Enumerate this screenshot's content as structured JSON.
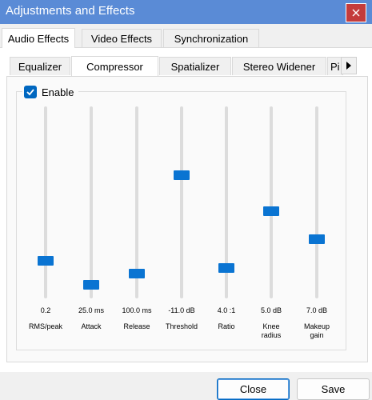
{
  "window": {
    "title": "Adjustments and Effects"
  },
  "outer_tabs": [
    "Audio Effects",
    "Video Effects",
    "Synchronization"
  ],
  "inner_tabs": [
    "Equalizer",
    "Compressor",
    "Spatializer",
    "Stereo Widener",
    "Pi"
  ],
  "compressor": {
    "enable_label": "Enable",
    "enabled": true,
    "sliders": [
      {
        "value": "0.2",
        "label": "RMS/peak",
        "level": 0.18
      },
      {
        "value": "25.0 ms",
        "label": "Attack",
        "level": 0.05
      },
      {
        "value": "100.0 ms",
        "label": "Release",
        "level": 0.11
      },
      {
        "value": "-11.0 dB",
        "label": "Threshold",
        "level": 0.65
      },
      {
        "value": "4.0 :1",
        "label": "Ratio",
        "level": 0.14
      },
      {
        "value": "5.0 dB",
        "label": "Knee radius",
        "label_lines": [
          "Knee",
          "radius"
        ],
        "level": 0.45
      },
      {
        "value": "7.0 dB",
        "label": "Makeup gain",
        "label_lines": [
          "Makeup",
          "gain"
        ],
        "level": 0.3
      }
    ]
  },
  "buttons": {
    "close": "Close",
    "save": "Save"
  },
  "colors": {
    "titlebar": "#5a8bd6",
    "accent": "#0a74d2",
    "close": "#c43c3c"
  }
}
